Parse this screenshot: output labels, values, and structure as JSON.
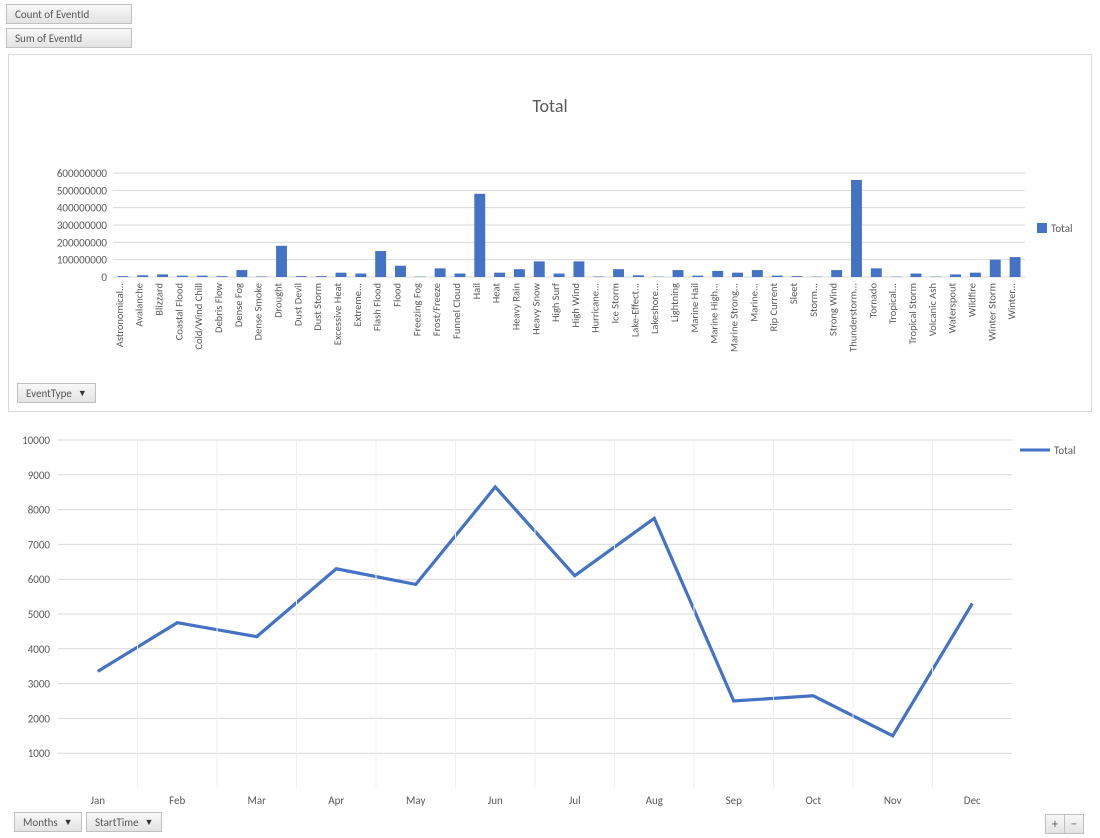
{
  "buttons": {
    "count_of_eventid": "Count of EventId",
    "sum_of_eventid": "Sum of EventId",
    "eventtype": "EventType",
    "months": "Months",
    "starttime": "StartTime"
  },
  "chart1_title": "Total",
  "legend_total": "Total",
  "chart_data": [
    {
      "type": "bar",
      "title": "Total",
      "ylabel": "",
      "xlabel": "",
      "ylim": [
        0,
        600000000
      ],
      "yticks": [
        0,
        100000000,
        200000000,
        300000000,
        400000000,
        500000000,
        600000000
      ],
      "categories": [
        "Astronomical...",
        "Avalanche",
        "Blizzard",
        "Coastal Flood",
        "Cold/Wind Chill",
        "Debris Flow",
        "Dense Fog",
        "Dense Smoke",
        "Drought",
        "Dust Devil",
        "Dust Storm",
        "Excessive Heat",
        "Extreme...",
        "Flash Flood",
        "Flood",
        "Freezing Fog",
        "Frost/Freeze",
        "Funnel Cloud",
        "Hail",
        "Heat",
        "Heavy Rain",
        "Heavy Snow",
        "High Surf",
        "High Wind",
        "Hurricane...",
        "Ice Storm",
        "Lake-Effect...",
        "Lakeshore...",
        "Lightning",
        "Marine Hail",
        "Marine High...",
        "Marine Strong...",
        "Marine...",
        "Rip Current",
        "Sleet",
        "Storm...",
        "Strong Wind",
        "Thunderstorm...",
        "Tornado",
        "Tropical...",
        "Tropical Storm",
        "Volcanic Ash",
        "Waterspout",
        "Wildfire",
        "Winter Storm",
        "Winter..."
      ],
      "values": [
        5000000,
        10000000,
        15000000,
        8000000,
        8000000,
        5000000,
        40000000,
        3000000,
        180000000,
        5000000,
        5000000,
        25000000,
        20000000,
        150000000,
        65000000,
        2000000,
        50000000,
        20000000,
        480000000,
        25000000,
        45000000,
        90000000,
        20000000,
        90000000,
        3000000,
        45000000,
        10000000,
        2000000,
        40000000,
        8000000,
        35000000,
        25000000,
        40000000,
        8000000,
        5000000,
        2000000,
        40000000,
        560000000,
        50000000,
        2000000,
        20000000,
        2000000,
        15000000,
        25000000,
        100000000,
        115000000
      ],
      "series_name": "Total"
    },
    {
      "type": "line",
      "title": "",
      "ylabel": "",
      "xlabel": "",
      "ylim": [
        0,
        10000
      ],
      "yticks": [
        1000,
        2000,
        3000,
        4000,
        5000,
        6000,
        7000,
        8000,
        9000,
        10000
      ],
      "categories": [
        "Jan",
        "Feb",
        "Mar",
        "Apr",
        "May",
        "Jun",
        "Jul",
        "Aug",
        "Sep",
        "Oct",
        "Nov",
        "Dec"
      ],
      "values": [
        3350,
        4750,
        4350,
        6300,
        5850,
        8650,
        6100,
        7750,
        2500,
        2650,
        1500,
        5300
      ],
      "series_name": "Total"
    }
  ]
}
